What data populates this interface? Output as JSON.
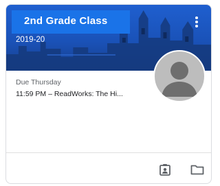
{
  "card": {
    "title": "2nd Grade Class",
    "subtitle": "2019-20",
    "due_label": "Due Thursday",
    "assignment": "11:59 PM – ReadWorks: The Hi...",
    "menu_icon": "more-vert-icon",
    "workbook_icon": "assignment-ind-icon",
    "folder_icon": "folder-icon"
  },
  "colors": {
    "banner": "#1a5bc6",
    "title_box": "#1a73e8",
    "avatar": "#bdbdbd",
    "divider": "#e0e0e0",
    "icon": "#5f6368"
  }
}
